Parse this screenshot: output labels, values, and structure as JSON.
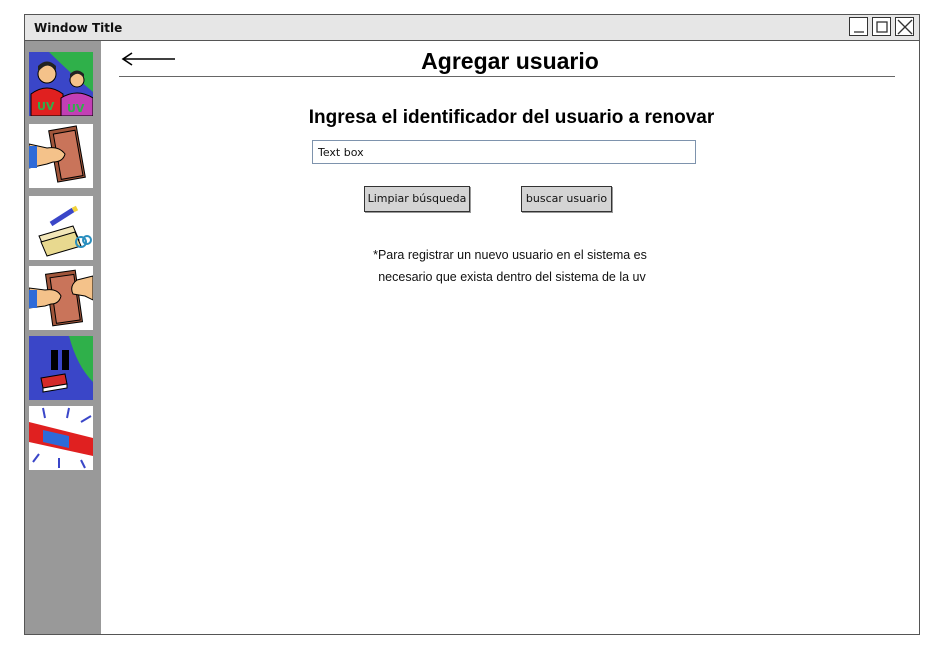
{
  "window": {
    "title": "Window Title",
    "controls": [
      "minimize",
      "maximize",
      "close"
    ]
  },
  "sidebar": {
    "items": [
      {
        "icon": "users-icon",
        "label": ""
      },
      {
        "icon": "book-loan-icon",
        "label": ""
      },
      {
        "icon": "register-icon",
        "label": ""
      },
      {
        "icon": "book-return-icon",
        "label": ""
      },
      {
        "icon": "pause-book-icon",
        "label": ""
      },
      {
        "icon": "alert-siren-icon",
        "label": ""
      }
    ]
  },
  "header": {
    "back_icon": "left-arrow-icon",
    "title": "Agregar usuario"
  },
  "form": {
    "prompt": "Ingresa el identificador del usuario a renovar",
    "textbox_value": "Text box",
    "clear_button": "Limpiar búsqueda",
    "search_button": "buscar usuario"
  },
  "note": {
    "line1": "*Para registrar un nuevo usuario en el sistema es",
    "line2": "necesario que exista dentro del sistema de la uv"
  },
  "colors": {
    "sidebar_bg": "#999999",
    "titlebar_bg": "#e6e6e6",
    "button_bg": "#d4d4d4",
    "textbox_border": "#7e93ad"
  }
}
